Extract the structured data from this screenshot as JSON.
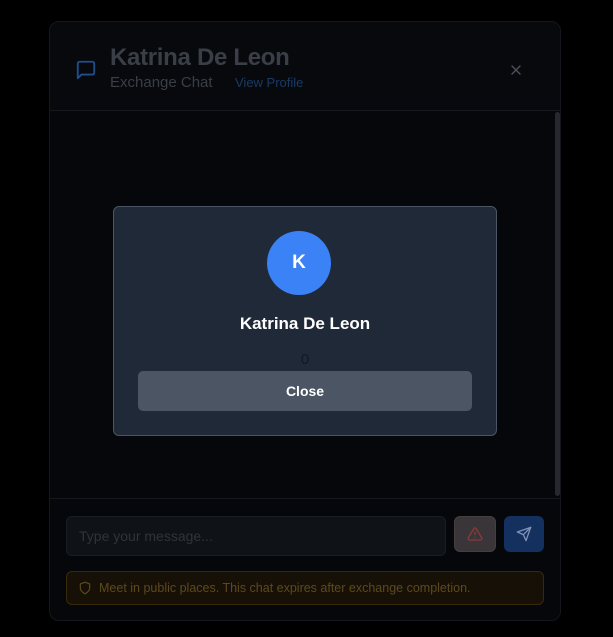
{
  "header": {
    "title": "Katrina De Leon",
    "subtitle": "Exchange Chat",
    "view_profile": "View Profile",
    "icon": "chat-icon",
    "close_icon": "close-icon"
  },
  "composer": {
    "placeholder": "Type your message...",
    "report_icon": "warning-icon",
    "send_icon": "send-icon"
  },
  "safety_notice": {
    "icon": "shield-icon",
    "text": "Meet in public places. This chat expires after exchange completion."
  },
  "profile_popup": {
    "initial": "K",
    "name": "Katrina De Leon",
    "count": "0",
    "close_label": "Close"
  },
  "colors": {
    "accent": "#3b82f6",
    "popup_bg": "#1f2937",
    "button_gray": "#4b5563"
  }
}
